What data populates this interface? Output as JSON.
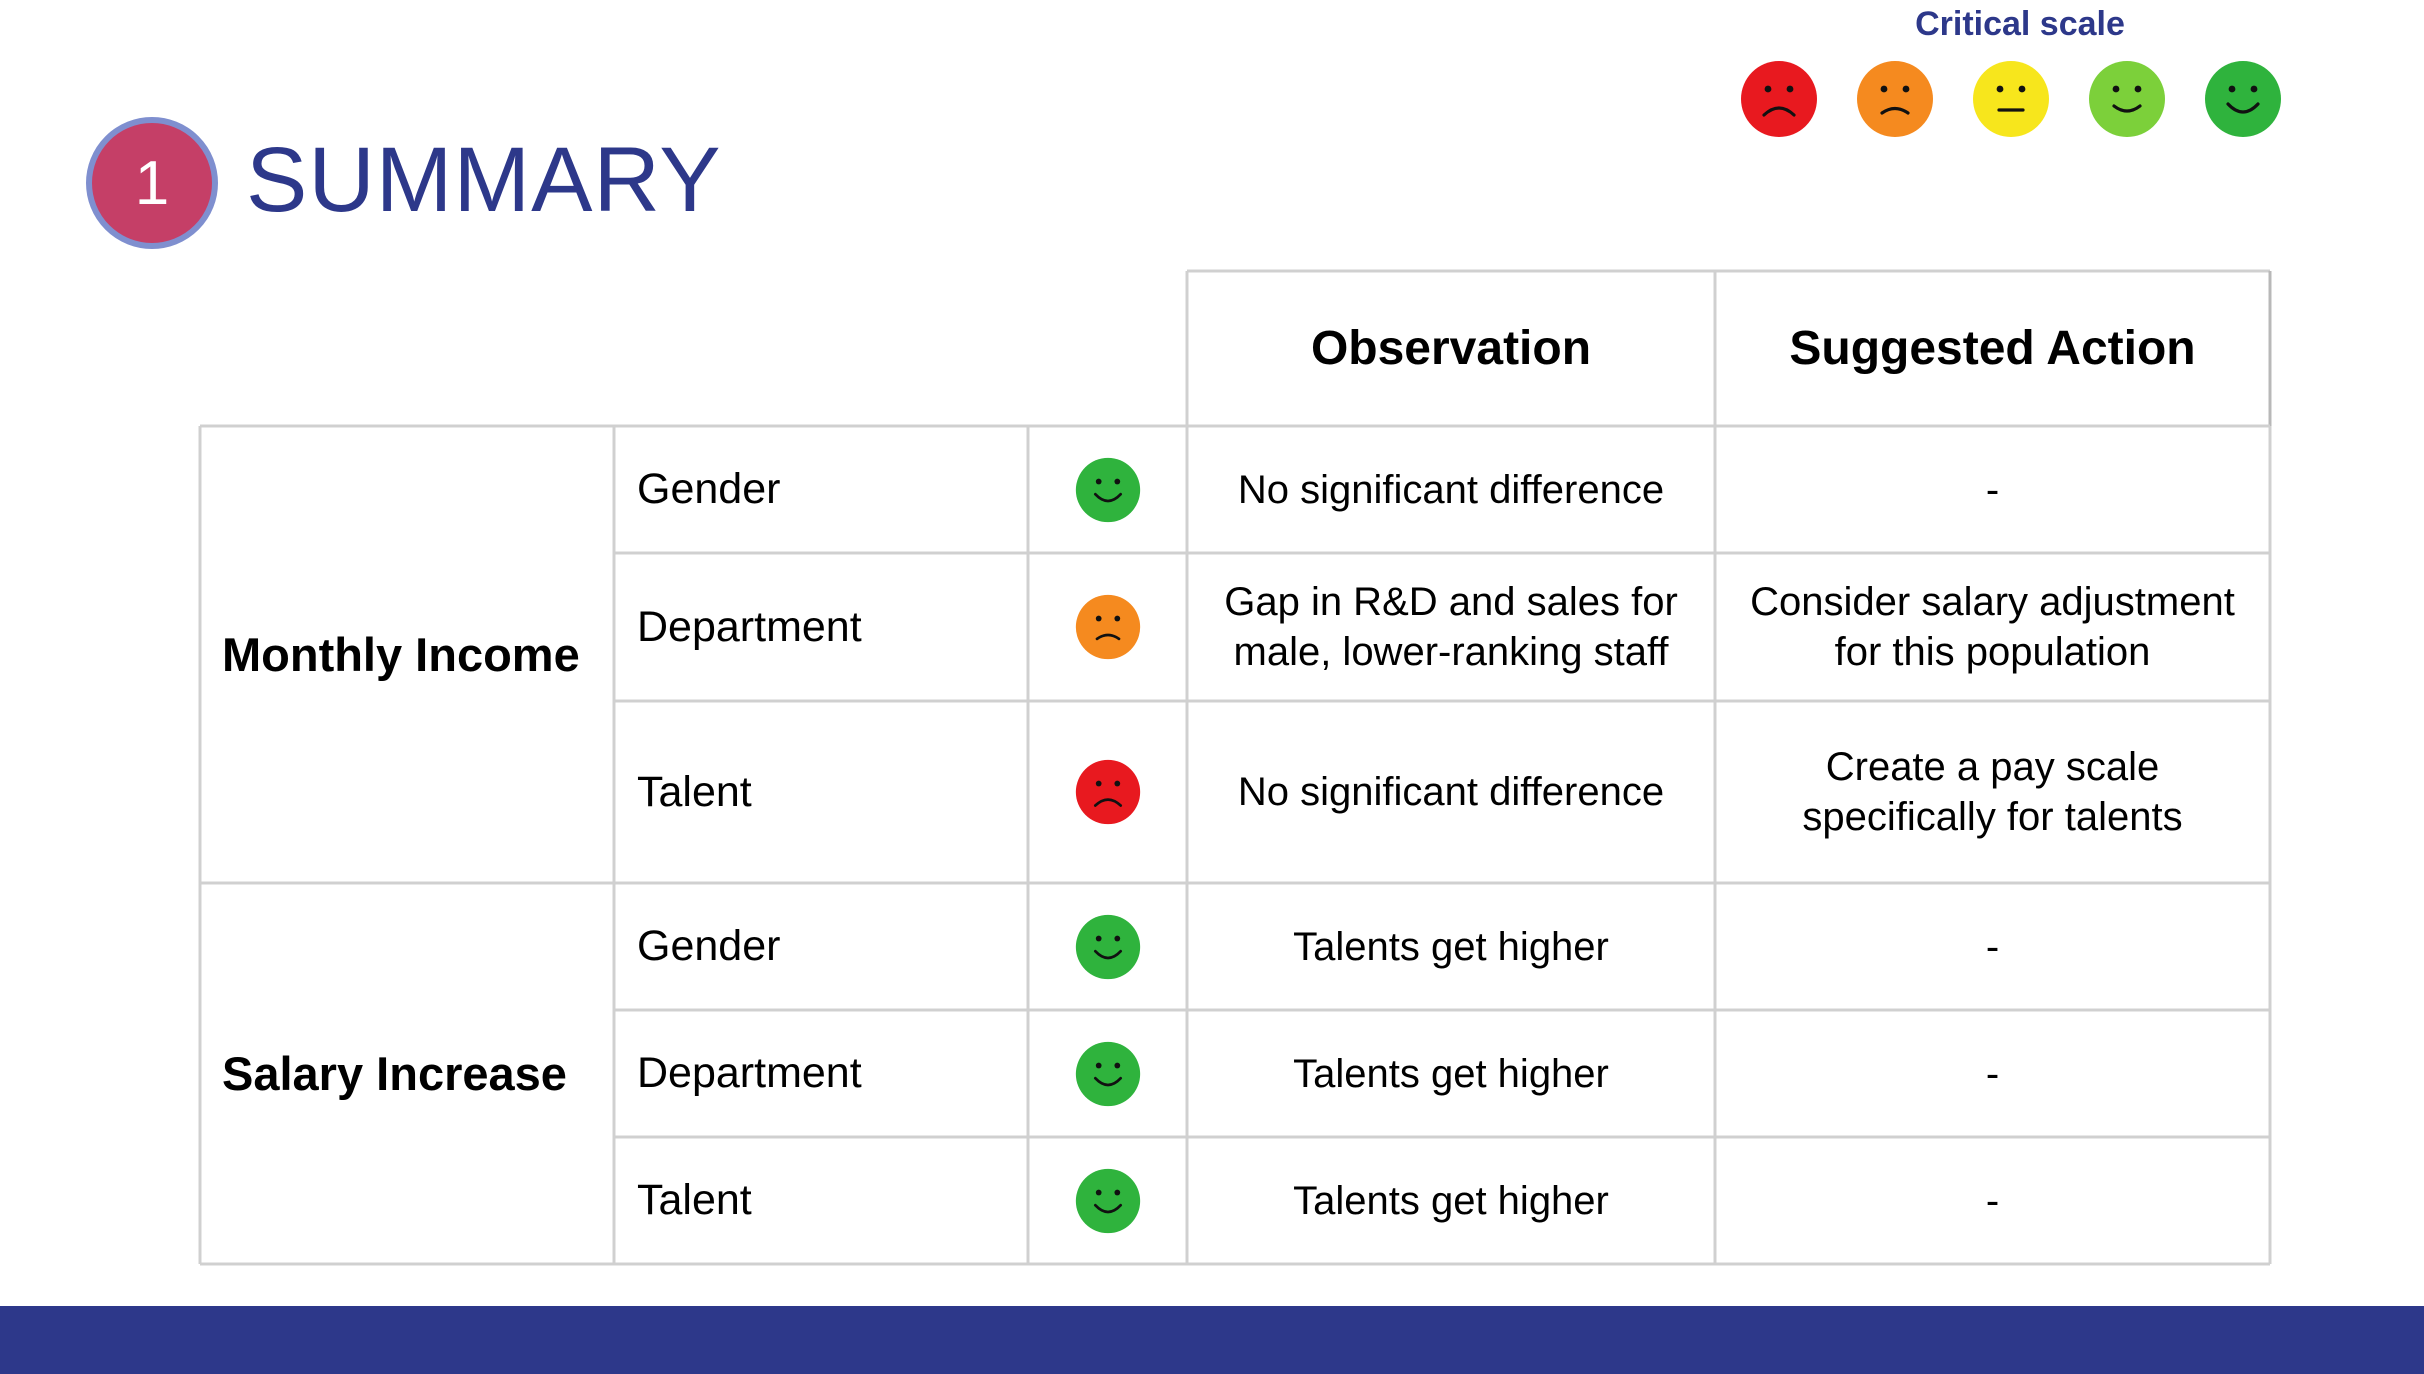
{
  "header": {
    "section_number": "1",
    "title": "SUMMARY"
  },
  "critical_scale": {
    "label": "Critical scale",
    "levels": [
      {
        "icon": "very-sad-face-icon",
        "color": "#e8191f"
      },
      {
        "icon": "sad-face-icon",
        "color": "#f58a1f"
      },
      {
        "icon": "neutral-face-icon",
        "color": "#f7e61c"
      },
      {
        "icon": "happy-face-icon",
        "color": "#7cd03a"
      },
      {
        "icon": "very-happy-face-icon",
        "color": "#2fb33d"
      }
    ]
  },
  "table": {
    "columns": {
      "observation": "Observation",
      "suggested_action": "Suggested Action"
    },
    "groups": [
      {
        "label": "Monthly Income"
      },
      {
        "label": "Salary Increase"
      }
    ],
    "rows": [
      {
        "sub": "Gender",
        "rating_icon": "very-happy-face-icon",
        "rating_color": "#2fb33d",
        "observation": "No significant difference",
        "action": "-"
      },
      {
        "sub": "Department",
        "rating_icon": "sad-face-icon",
        "rating_color": "#f58a1f",
        "observation": "Gap in R&D and sales for\nmale, lower-ranking staff",
        "action": "Consider salary adjustment\nfor this population"
      },
      {
        "sub": "Talent",
        "rating_icon": "very-sad-face-icon",
        "rating_color": "#e8191f",
        "observation": "No significant difference",
        "action": "Create a pay scale\nspecifically for talents"
      },
      {
        "sub": "Gender",
        "rating_icon": "very-happy-face-icon",
        "rating_color": "#2fb33d",
        "observation": "Talents get higher",
        "action": "-"
      },
      {
        "sub": "Department",
        "rating_icon": "very-happy-face-icon",
        "rating_color": "#2fb33d",
        "observation": "Talents get higher",
        "action": "-"
      },
      {
        "sub": "Talent",
        "rating_icon": "very-happy-face-icon",
        "rating_color": "#2fb33d",
        "observation": "Talents get higher",
        "action": "-"
      }
    ]
  },
  "colors": {
    "brand_blue": "#2d388a",
    "badge_fill": "#c53f67",
    "badge_ring": "#7f8fcf",
    "grid_line": "#d0d0d0"
  }
}
